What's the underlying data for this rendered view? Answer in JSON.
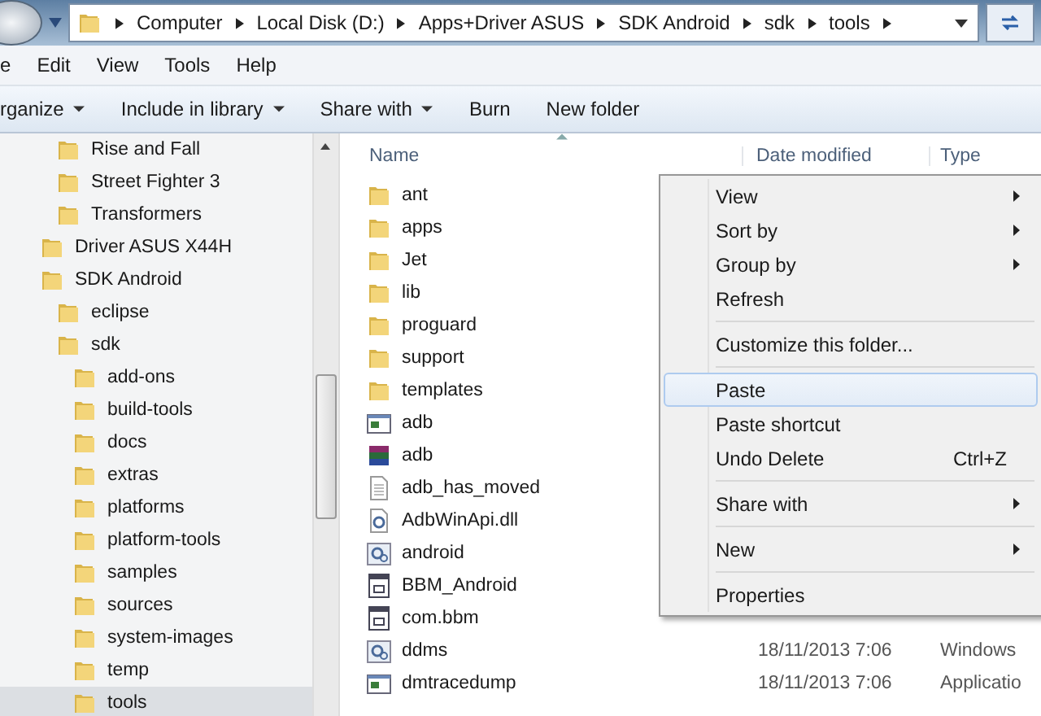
{
  "address_bar": {
    "crumbs": [
      "Computer",
      "Local Disk (D:)",
      "Apps+Driver ASUS",
      "SDK Android",
      "sdk",
      "tools"
    ]
  },
  "menu_bar": [
    "e",
    "Edit",
    "View",
    "Tools",
    "Help"
  ],
  "toolbar": [
    {
      "label": "rganize",
      "dropdown": true
    },
    {
      "label": "Include in library",
      "dropdown": true
    },
    {
      "label": "Share with",
      "dropdown": true
    },
    {
      "label": "Burn",
      "dropdown": false
    },
    {
      "label": "New folder",
      "dropdown": false
    }
  ],
  "tree": [
    {
      "children": [
        {
          "label": "Rise and Fall",
          "selected": false
        },
        {
          "label": "Street Fighter 3",
          "selected": false
        },
        {
          "label": "Transformers",
          "selected": false
        }
      ]
    },
    {
      "label": "Driver ASUS X44H",
      "selected": false
    },
    {
      "label": "SDK Android",
      "selected": false,
      "children": [
        {
          "label": "eclipse",
          "selected": false
        },
        {
          "label": "sdk",
          "selected": false,
          "children": [
            {
              "label": "add-ons",
              "selected": false
            },
            {
              "label": "build-tools",
              "selected": false
            },
            {
              "label": "docs",
              "selected": false
            },
            {
              "label": "extras",
              "selected": false
            },
            {
              "label": "platforms",
              "selected": false
            },
            {
              "label": "platform-tools",
              "selected": false
            },
            {
              "label": "samples",
              "selected": false
            },
            {
              "label": "sources",
              "selected": false
            },
            {
              "label": "system-images",
              "selected": false
            },
            {
              "label": "temp",
              "selected": false
            },
            {
              "label": "tools",
              "selected": true
            }
          ]
        }
      ]
    }
  ],
  "file_list": {
    "columns": [
      "Name",
      "Date modified",
      "Type"
    ],
    "rows": [
      {
        "name": "ant",
        "kind": "folder"
      },
      {
        "name": "apps",
        "kind": "folder"
      },
      {
        "name": "Jet",
        "kind": "folder"
      },
      {
        "name": "lib",
        "kind": "folder"
      },
      {
        "name": "proguard",
        "kind": "folder"
      },
      {
        "name": "support",
        "kind": "folder"
      },
      {
        "name": "templates",
        "kind": "folder"
      },
      {
        "name": "adb",
        "kind": "console"
      },
      {
        "name": "adb",
        "kind": "archive"
      },
      {
        "name": "adb_has_moved",
        "kind": "text"
      },
      {
        "name": "AdbWinApi.dll",
        "kind": "dll"
      },
      {
        "name": "android",
        "kind": "gear"
      },
      {
        "name": "BBM_Android",
        "kind": "script"
      },
      {
        "name": "com.bbm",
        "kind": "script"
      },
      {
        "name": "ddms",
        "kind": "gear",
        "date": "18/11/2013 7:06",
        "type": "Windows"
      },
      {
        "name": "dmtracedump",
        "kind": "console",
        "date": "18/11/2013 7:06",
        "type": "Applicatio"
      }
    ]
  },
  "context_menu": [
    {
      "kind": "item",
      "label": "View",
      "submenu": true,
      "selected": false
    },
    {
      "kind": "item",
      "label": "Sort by",
      "submenu": true,
      "selected": false
    },
    {
      "kind": "item",
      "label": "Group by",
      "submenu": true,
      "selected": false
    },
    {
      "kind": "item",
      "label": "Refresh",
      "submenu": false,
      "selected": false
    },
    {
      "kind": "separator"
    },
    {
      "kind": "item",
      "label": "Customize this folder...",
      "submenu": false,
      "selected": false
    },
    {
      "kind": "separator"
    },
    {
      "kind": "item",
      "label": "Paste",
      "submenu": false,
      "selected": true
    },
    {
      "kind": "item",
      "label": "Paste shortcut",
      "submenu": false,
      "selected": false
    },
    {
      "kind": "item",
      "label": "Undo Delete",
      "shortcut": "Ctrl+Z",
      "submenu": false,
      "selected": false
    },
    {
      "kind": "separator"
    },
    {
      "kind": "item",
      "label": "Share with",
      "submenu": true,
      "selected": false
    },
    {
      "kind": "separator"
    },
    {
      "kind": "item",
      "label": "New",
      "submenu": true,
      "selected": false
    },
    {
      "kind": "separator"
    },
    {
      "kind": "item",
      "label": "Properties",
      "submenu": false,
      "selected": false
    }
  ]
}
